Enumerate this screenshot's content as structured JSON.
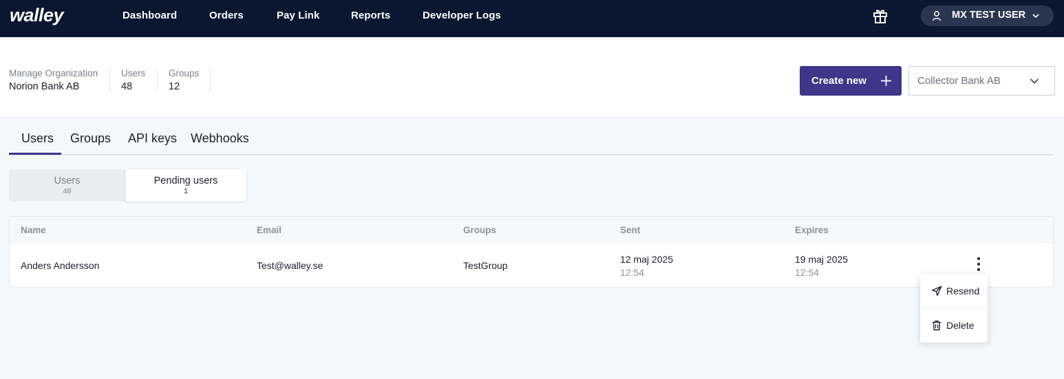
{
  "brand": {
    "logo_text": "walley"
  },
  "nav": {
    "items": [
      {
        "label": "Dashboard"
      },
      {
        "label": "Orders"
      },
      {
        "label": "Pay Link"
      },
      {
        "label": "Reports"
      },
      {
        "label": "Developer Logs"
      }
    ],
    "user_name": "MX TEST USER"
  },
  "org": {
    "manage_label": "Manage Organization",
    "name": "Norion Bank AB",
    "users_label": "Users",
    "users_count": "48",
    "groups_label": "Groups",
    "groups_count": "12"
  },
  "actions": {
    "create_label": "Create new",
    "org_select_value": "Collector Bank AB"
  },
  "tabs": [
    {
      "label": "Users",
      "active": true
    },
    {
      "label": "Groups"
    },
    {
      "label": "API keys"
    },
    {
      "label": "Webhooks"
    }
  ],
  "segments": [
    {
      "label": "Users",
      "count": "48"
    },
    {
      "label": "Pending users",
      "count": "1",
      "active": true
    }
  ],
  "table": {
    "headers": [
      "Name",
      "Email",
      "Groups",
      "Sent",
      "Expires"
    ],
    "rows": [
      {
        "name": "Anders Andersson",
        "email": "Test@walley.se",
        "groups": "TestGroup",
        "sent_date": "12 maj 2025",
        "sent_time": "12:54",
        "expires_date": "19 maj 2025",
        "expires_time": "12:54"
      }
    ]
  },
  "row_menu": {
    "items": [
      {
        "label": "Resend",
        "icon": "send-icon"
      },
      {
        "label": "Delete",
        "icon": "trash-icon"
      }
    ]
  },
  "colors": {
    "topbar": "#0b1630",
    "accent": "#3f358a",
    "background": "#f5f8fb"
  }
}
